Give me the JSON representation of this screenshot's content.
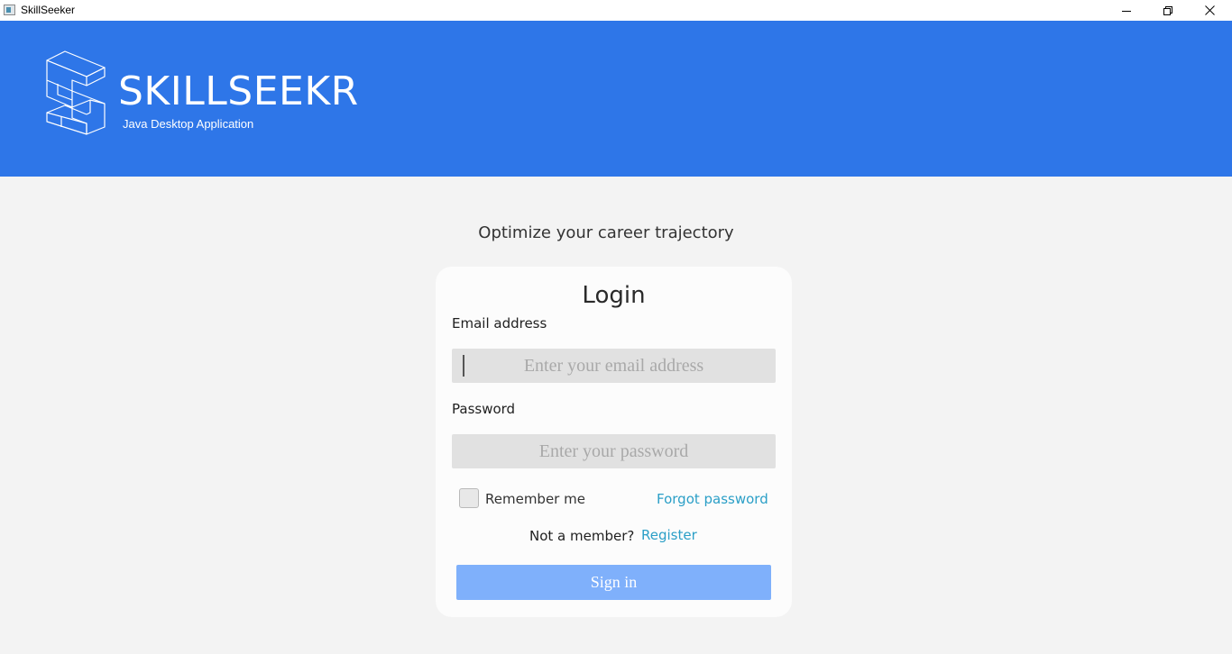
{
  "window": {
    "title": "SkillSeeker"
  },
  "header": {
    "brand": "SKILLSEEKR",
    "subtitle": "Java Desktop Application",
    "background": "#2e76e8"
  },
  "main": {
    "tagline": "Optimize your career trajectory",
    "login": {
      "title": "Login",
      "email_label": "Email address",
      "email_placeholder": "Enter your email address",
      "email_value": "",
      "password_label": "Password",
      "password_placeholder": "Enter your password",
      "password_value": "",
      "remember_label": "Remember me",
      "remember_checked": false,
      "forgot_label": "Forgot password",
      "not_member_label": "Not a member?",
      "register_label": "Register",
      "signin_label": "Sign in"
    }
  },
  "colors": {
    "accent": "#2e76e8",
    "link": "#2b9fc7",
    "button": "#7fb0fb"
  }
}
